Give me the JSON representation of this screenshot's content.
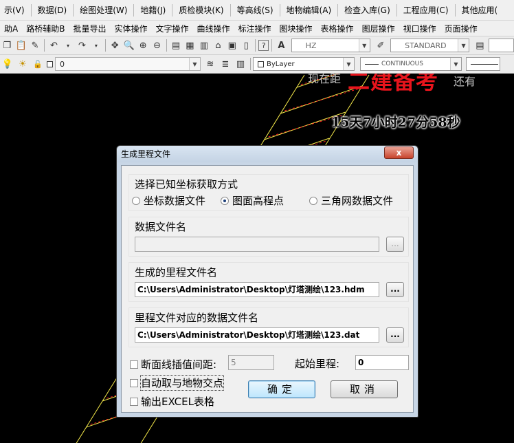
{
  "menubar": {
    "items": [
      "示(V)",
      "数据(D)",
      "绘图处理(W)",
      "地籍(J)",
      "质检模块(K)",
      "等高线(S)",
      "地物编辑(A)",
      "检查入库(G)",
      "工程应用(C)",
      "其他应用("
    ]
  },
  "toolbar2": {
    "items": [
      "助A",
      "路桥辅助B",
      "批量导出",
      "实体操作",
      "文字操作",
      "曲线操作",
      "标注操作",
      "图块操作",
      "表格操作",
      "图层操作",
      "视口操作",
      "页面操作"
    ]
  },
  "toolbar3": {
    "text_style": "HZ",
    "dim_style": "STANDARD",
    "right_glyph": "A"
  },
  "toolbar4": {
    "layer_value": "0",
    "color_value": "ByLayer",
    "linetype_value": "CONTINUOUS"
  },
  "canvas": {
    "watermark": "二建备考",
    "overlay_left": "现在距",
    "overlay_right": "还有",
    "countdown": "15天7小时27分58秒",
    "line_color": "#f5e94a",
    "dash_color": "#ff2020"
  },
  "dialog": {
    "title": "生成里程文件",
    "close_label": "x",
    "group1": {
      "label": "选择已知坐标获取方式",
      "options": [
        "坐标数据文件",
        "图面高程点",
        "三角网数据文件"
      ],
      "selected_index": 1
    },
    "group2": {
      "label": "数据文件名",
      "value": "",
      "browse": "..."
    },
    "group3": {
      "label": "生成的里程文件名",
      "value": "C:\\Users\\Administrator\\Desktop\\灯塔测绘\\123.hdm",
      "browse": "..."
    },
    "group4": {
      "label": "里程文件对应的数据文件名",
      "value": "C:\\Users\\Administrator\\Desktop\\灯塔测绘\\123.dat",
      "browse": "..."
    },
    "interp_label": "断面线插值间距:",
    "interp_value": "5",
    "start_label": "起始里程:",
    "start_value": "0",
    "auto_label": "自动取与地物交点",
    "excel_label": "输出EXCEL表格",
    "ok_label": "确定",
    "cancel_label": "取消"
  }
}
